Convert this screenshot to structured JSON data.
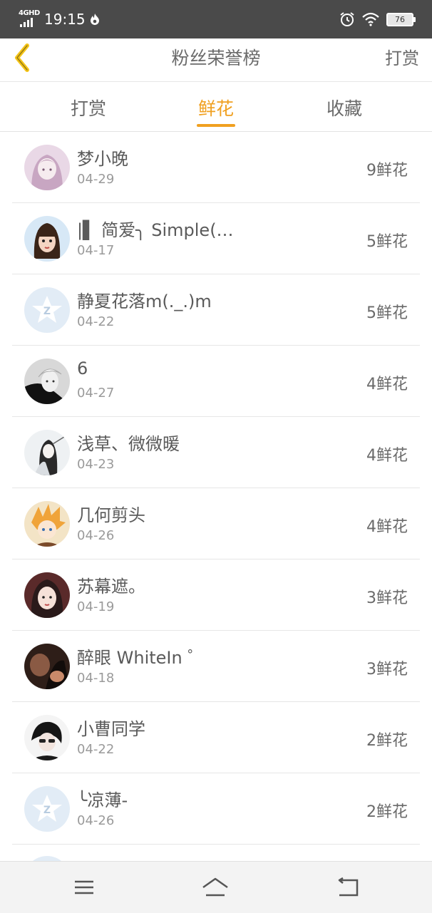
{
  "status_bar": {
    "network": "4GHD",
    "time": "19:15",
    "battery": "76",
    "icons": [
      "signal-icon",
      "flame-icon",
      "alarm-icon",
      "wifi-icon",
      "battery-icon"
    ]
  },
  "header": {
    "title": "粉丝荣誉榜",
    "action": "打赏"
  },
  "tabs": [
    {
      "label": "打赏",
      "active": false
    },
    {
      "label": "鲜花",
      "active": true
    },
    {
      "label": "收藏",
      "active": false
    }
  ],
  "colors": {
    "accent": "#f0a020",
    "status_bar": "#4a4a4a",
    "back_arrow": "#f5c518"
  },
  "fans": [
    {
      "name": "梦小晚",
      "date": "04-29",
      "count": "9鲜花",
      "avatar": "anime-girl"
    },
    {
      "name": "|▌ 简爱╮ Simple(…",
      "date": "04-17",
      "count": "5鲜花",
      "avatar": "girl-bangs"
    },
    {
      "name": "静夏花落m(._.)m",
      "date": "04-22",
      "count": "5鲜花",
      "avatar": "qq-default"
    },
    {
      "name": "6",
      "date": "04-27",
      "count": "4鲜花",
      "avatar": "bw-boy"
    },
    {
      "name": "浅草、微微暖",
      "date": "04-23",
      "count": "4鲜花",
      "avatar": "ink-girl"
    },
    {
      "name": "几何剪头",
      "date": "04-26",
      "count": "4鲜花",
      "avatar": "anime-boy"
    },
    {
      "name": "苏幕遮。",
      "date": "04-19",
      "count": "3鲜花",
      "avatar": "girl-photo"
    },
    {
      "name": "醉眼 WhiteIn ゜",
      "date": "04-18",
      "count": "3鲜花",
      "avatar": "dark-photo"
    },
    {
      "name": "小曹同学",
      "date": "04-22",
      "count": "2鲜花",
      "avatar": "boy-glasses"
    },
    {
      "name": "╰凉薄-",
      "date": "04-26",
      "count": "2鲜花",
      "avatar": "qq-default"
    }
  ],
  "navbar": {
    "icons": [
      "menu-icon",
      "home-icon",
      "back-nav-icon"
    ]
  }
}
